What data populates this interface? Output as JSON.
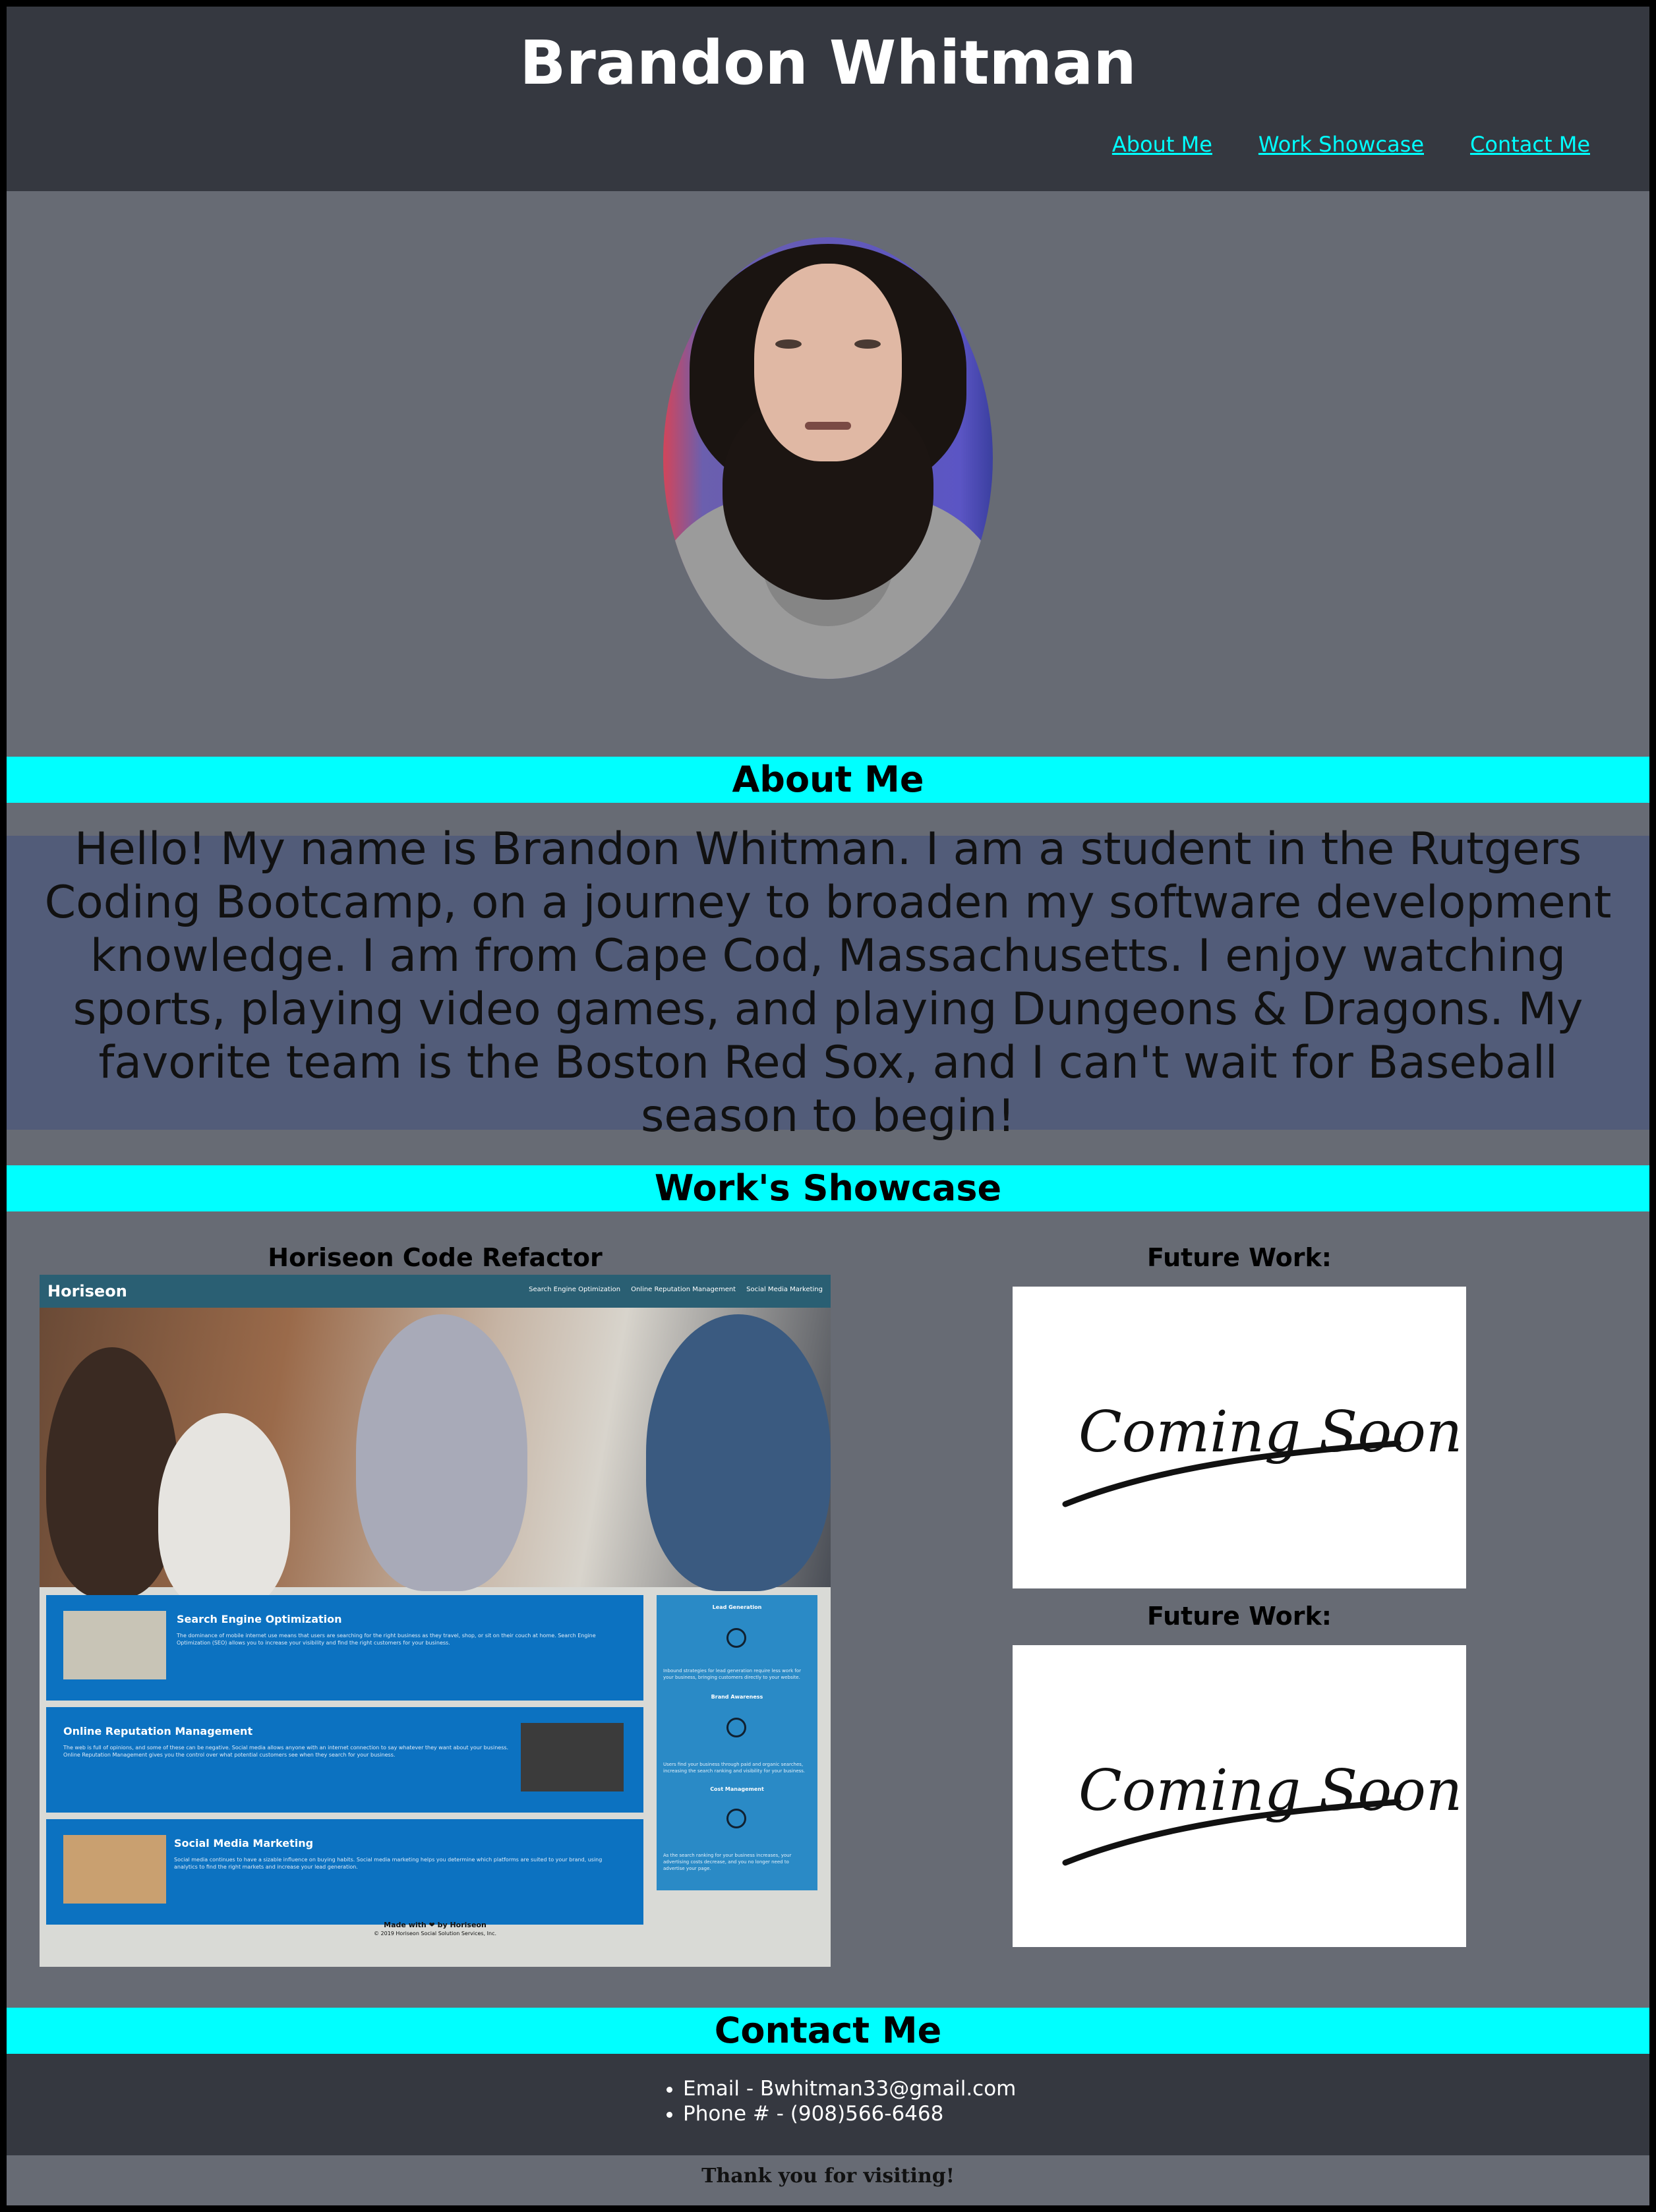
{
  "header": {
    "title": "Brandon Whitman",
    "nav": [
      "About Me",
      "Work Showcase",
      "Contact Me"
    ]
  },
  "profile_photo": "portrait photo",
  "about": {
    "heading": "About Me",
    "text": "Hello! My name is Brandon Whitman. I am a student in the Rutgers Coding Bootcamp, on a journey to broaden my software development knowledge. I am from Cape Cod, Massachusetts. I enjoy watching sports, playing video games, and playing Dungeons & Dragons. My favorite team is the Boston Red Sox, and I can't wait for Baseball season to begin!"
  },
  "work": {
    "heading": "Work's Showcase",
    "project": {
      "title": "Horiseon Code Refactor",
      "screenshot": {
        "brand": "Horiseon",
        "links": [
          "Search Engine Optimization",
          "Online Reputation Management",
          "Social Media Marketing"
        ],
        "cards": [
          {
            "title": "Search Engine Optimization",
            "text": "The dominance of mobile internet use means that users are searching for the right business as they travel, shop, or sit on their couch at home. Search Engine Optimization (SEO) allows you to increase your visibility and find the right customers for your business."
          },
          {
            "title": "Online Reputation Management",
            "text": "The web is full of opinions, and some of these can be negative. Social media allows anyone with an internet connection to say whatever they want about your business. Online Reputation Management gives you the control over what potential customers see when they search for your business."
          },
          {
            "title": "Social Media Marketing",
            "text": "Social media continues to have a sizable influence on buying habits. Social media marketing helps you determine which platforms are suited to your brand, using analytics to find the right markets and increase your lead generation."
          }
        ],
        "aside": [
          {
            "title": "Lead Generation",
            "text": "Inbound strategies for lead generation require less work for your business, bringing customers directly to your website."
          },
          {
            "title": "Brand Awareness",
            "text": "Users find your business through paid and organic searches, increasing the search ranking and visibility for your business."
          },
          {
            "title": "Cost Management",
            "text": "As the search ranking for your business increases, your advertising costs decrease, and you no longer need to advertise your page."
          }
        ],
        "footer_made": "Made with ❤ by Horiseon",
        "footer_copy": "© 2019 Horiseon Social Solution Services, Inc."
      }
    },
    "future": [
      {
        "label": "Future Work:",
        "image_text": "Coming Soon!"
      },
      {
        "label": "Future Work:",
        "image_text": "Coming Soon!"
      }
    ]
  },
  "contact": {
    "heading": "Contact Me",
    "items": [
      "Email - Bwhitman33@gmail.com",
      "Phone # - (908)566-6468"
    ]
  },
  "footer": {
    "text": "Thank you for visiting!"
  },
  "colors": {
    "accent": "#00ffff",
    "header_bg": "#353840",
    "page_bg": "#676b74",
    "bio_bg": "#525c79"
  }
}
